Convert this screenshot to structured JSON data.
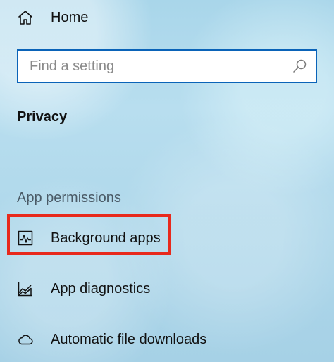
{
  "nav": {
    "home_label": "Home"
  },
  "search": {
    "placeholder": "Find a setting"
  },
  "section": {
    "title": "Privacy"
  },
  "app_permissions": {
    "heading": "App permissions",
    "items": [
      {
        "label": "Background apps",
        "icon": "background-apps-icon",
        "highlighted": true
      },
      {
        "label": "App diagnostics",
        "icon": "app-diagnostics-icon"
      },
      {
        "label": "Automatic file downloads",
        "icon": "cloud-icon"
      }
    ]
  },
  "colors": {
    "highlight_border": "#e8291c",
    "search_border": "#0a63b8"
  }
}
